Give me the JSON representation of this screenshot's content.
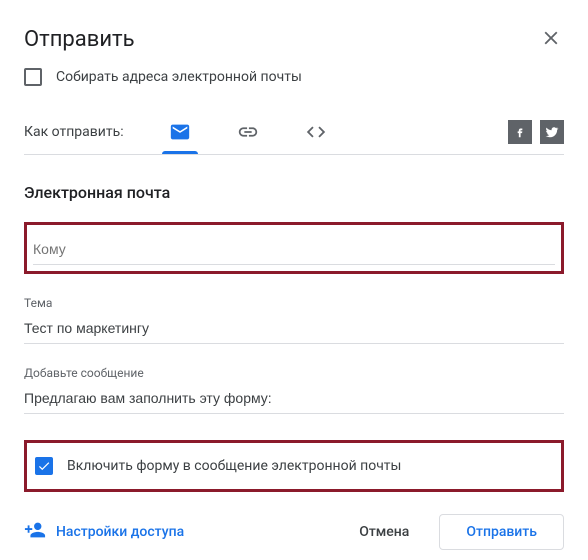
{
  "dialog": {
    "title": "Отправить"
  },
  "collect": {
    "label": "Собирать адреса электронной почты",
    "checked": false
  },
  "send_via": {
    "label": "Как отправить:",
    "tabs": [
      "email",
      "link",
      "embed"
    ],
    "active": "email"
  },
  "email_section": {
    "title": "Электронная почта",
    "to": {
      "placeholder": "Кому",
      "value": ""
    },
    "subject": {
      "label": "Тема",
      "value": "Тест по маркетингу"
    },
    "message": {
      "label": "Добавьте сообщение",
      "value": "Предлагаю вам заполнить эту форму:"
    },
    "include_form": {
      "label": "Включить форму в сообщение электронной почты",
      "checked": true
    }
  },
  "footer": {
    "settings": "Настройки доступа",
    "cancel": "Отмена",
    "send": "Отправить"
  }
}
